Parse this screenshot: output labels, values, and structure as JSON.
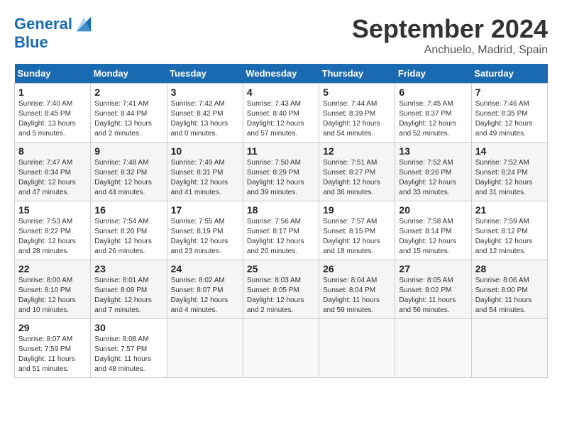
{
  "header": {
    "logo_line1": "General",
    "logo_line2": "Blue",
    "month": "September 2024",
    "location": "Anchuelo, Madrid, Spain"
  },
  "weekdays": [
    "Sunday",
    "Monday",
    "Tuesday",
    "Wednesday",
    "Thursday",
    "Friday",
    "Saturday"
  ],
  "weeks": [
    [
      {
        "day": "1",
        "info": "Sunrise: 7:40 AM\nSunset: 8:45 PM\nDaylight: 13 hours\nand 5 minutes."
      },
      {
        "day": "2",
        "info": "Sunrise: 7:41 AM\nSunset: 8:44 PM\nDaylight: 13 hours\nand 2 minutes."
      },
      {
        "day": "3",
        "info": "Sunrise: 7:42 AM\nSunset: 8:42 PM\nDaylight: 13 hours\nand 0 minutes."
      },
      {
        "day": "4",
        "info": "Sunrise: 7:43 AM\nSunset: 8:40 PM\nDaylight: 12 hours\nand 57 minutes."
      },
      {
        "day": "5",
        "info": "Sunrise: 7:44 AM\nSunset: 8:39 PM\nDaylight: 12 hours\nand 54 minutes."
      },
      {
        "day": "6",
        "info": "Sunrise: 7:45 AM\nSunset: 8:37 PM\nDaylight: 12 hours\nand 52 minutes."
      },
      {
        "day": "7",
        "info": "Sunrise: 7:46 AM\nSunset: 8:35 PM\nDaylight: 12 hours\nand 49 minutes."
      }
    ],
    [
      {
        "day": "8",
        "info": "Sunrise: 7:47 AM\nSunset: 8:34 PM\nDaylight: 12 hours\nand 47 minutes."
      },
      {
        "day": "9",
        "info": "Sunrise: 7:48 AM\nSunset: 8:32 PM\nDaylight: 12 hours\nand 44 minutes."
      },
      {
        "day": "10",
        "info": "Sunrise: 7:49 AM\nSunset: 8:31 PM\nDaylight: 12 hours\nand 41 minutes."
      },
      {
        "day": "11",
        "info": "Sunrise: 7:50 AM\nSunset: 8:29 PM\nDaylight: 12 hours\nand 39 minutes."
      },
      {
        "day": "12",
        "info": "Sunrise: 7:51 AM\nSunset: 8:27 PM\nDaylight: 12 hours\nand 36 minutes."
      },
      {
        "day": "13",
        "info": "Sunrise: 7:52 AM\nSunset: 8:26 PM\nDaylight: 12 hours\nand 33 minutes."
      },
      {
        "day": "14",
        "info": "Sunrise: 7:52 AM\nSunset: 8:24 PM\nDaylight: 12 hours\nand 31 minutes."
      }
    ],
    [
      {
        "day": "15",
        "info": "Sunrise: 7:53 AM\nSunset: 8:22 PM\nDaylight: 12 hours\nand 28 minutes."
      },
      {
        "day": "16",
        "info": "Sunrise: 7:54 AM\nSunset: 8:20 PM\nDaylight: 12 hours\nand 26 minutes."
      },
      {
        "day": "17",
        "info": "Sunrise: 7:55 AM\nSunset: 8:19 PM\nDaylight: 12 hours\nand 23 minutes."
      },
      {
        "day": "18",
        "info": "Sunrise: 7:56 AM\nSunset: 8:17 PM\nDaylight: 12 hours\nand 20 minutes."
      },
      {
        "day": "19",
        "info": "Sunrise: 7:57 AM\nSunset: 8:15 PM\nDaylight: 12 hours\nand 18 minutes."
      },
      {
        "day": "20",
        "info": "Sunrise: 7:58 AM\nSunset: 8:14 PM\nDaylight: 12 hours\nand 15 minutes."
      },
      {
        "day": "21",
        "info": "Sunrise: 7:59 AM\nSunset: 8:12 PM\nDaylight: 12 hours\nand 12 minutes."
      }
    ],
    [
      {
        "day": "22",
        "info": "Sunrise: 8:00 AM\nSunset: 8:10 PM\nDaylight: 12 hours\nand 10 minutes."
      },
      {
        "day": "23",
        "info": "Sunrise: 8:01 AM\nSunset: 8:09 PM\nDaylight: 12 hours\nand 7 minutes."
      },
      {
        "day": "24",
        "info": "Sunrise: 8:02 AM\nSunset: 8:07 PM\nDaylight: 12 hours\nand 4 minutes."
      },
      {
        "day": "25",
        "info": "Sunrise: 8:03 AM\nSunset: 8:05 PM\nDaylight: 12 hours\nand 2 minutes."
      },
      {
        "day": "26",
        "info": "Sunrise: 8:04 AM\nSunset: 8:04 PM\nDaylight: 11 hours\nand 59 minutes."
      },
      {
        "day": "27",
        "info": "Sunrise: 8:05 AM\nSunset: 8:02 PM\nDaylight: 11 hours\nand 56 minutes."
      },
      {
        "day": "28",
        "info": "Sunrise: 8:06 AM\nSunset: 8:00 PM\nDaylight: 11 hours\nand 54 minutes."
      }
    ],
    [
      {
        "day": "29",
        "info": "Sunrise: 8:07 AM\nSunset: 7:59 PM\nDaylight: 11 hours\nand 51 minutes."
      },
      {
        "day": "30",
        "info": "Sunrise: 8:08 AM\nSunset: 7:57 PM\nDaylight: 11 hours\nand 48 minutes."
      },
      {
        "day": "",
        "info": ""
      },
      {
        "day": "",
        "info": ""
      },
      {
        "day": "",
        "info": ""
      },
      {
        "day": "",
        "info": ""
      },
      {
        "day": "",
        "info": ""
      }
    ]
  ]
}
